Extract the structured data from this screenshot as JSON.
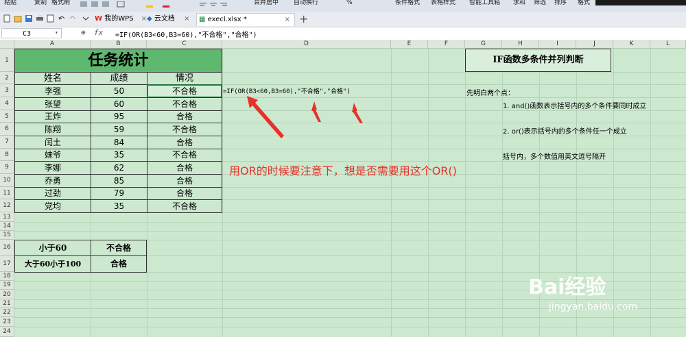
{
  "ribbon": {
    "labels": [
      "粘贴",
      "复制",
      "格式刷",
      "合并居中",
      "自动换行",
      "条件格式",
      "表格样式",
      "智能工具箱",
      "求和",
      "筛选",
      "排序",
      "格式"
    ],
    "percent": "%"
  },
  "tabs": [
    {
      "label": "我的WPS"
    },
    {
      "label": "云文档"
    },
    {
      "label": "execl.xlsx *"
    }
  ],
  "formula_bar": {
    "cell_ref": "C3",
    "fx": "fx",
    "formula": "=IF(OR(B3<60,B3=60),\"不合格\",\"合格\")"
  },
  "columns": [
    "A",
    "B",
    "C",
    "D",
    "E",
    "F",
    "G",
    "H",
    "I",
    "J",
    "K",
    "L"
  ],
  "rows": [
    "1",
    "2",
    "3",
    "4",
    "5",
    "6",
    "7",
    "8",
    "9",
    "10",
    "11",
    "12",
    "13",
    "14",
    "15",
    "16",
    "17",
    "18",
    "19",
    "20",
    "21",
    "22",
    "23",
    "24"
  ],
  "table": {
    "title": "任务统计",
    "headers": [
      "姓名",
      "成绩",
      "情况"
    ],
    "records": [
      {
        "name": "李强",
        "score": "50",
        "status": "不合格"
      },
      {
        "name": "张望",
        "score": "60",
        "status": "不合格"
      },
      {
        "name": "王炸",
        "score": "95",
        "status": "合格"
      },
      {
        "name": "陈翔",
        "score": "59",
        "status": "不合格"
      },
      {
        "name": "闰土",
        "score": "84",
        "status": "合格"
      },
      {
        "name": "妹爷",
        "score": "35",
        "status": "不合格"
      },
      {
        "name": "李娜",
        "score": "62",
        "status": "合格"
      },
      {
        "name": "乔勇",
        "score": "85",
        "status": "合格"
      },
      {
        "name": "过劲",
        "score": "79",
        "status": "合格"
      },
      {
        "name": "党均",
        "score": "35",
        "status": "不合格"
      }
    ]
  },
  "legend": [
    {
      "condition": "小于60",
      "result": "不合格"
    },
    {
      "condition": "大于60小于100",
      "result": "合格"
    }
  ],
  "annotation": {
    "d3_formula": "=IF(OR(B3<60,B3=60),\"不合格\",\"合格\")",
    "note": "用OR的时候要注意下，想是否需要用这个OR()"
  },
  "side": {
    "title": "IF函数多条件并列判断",
    "intro": "先明白两个点：",
    "point1": "1. and()函数表示括号内的多个条件要同时成立",
    "point2": "2. or()表示括号内的多个条件任一个成立",
    "point3": "括号内，多个数值用英文逗号隔开"
  },
  "watermark": {
    "brand": "Bai经验",
    "url": "jingyan.baidu.com"
  },
  "colors": {
    "accent_red": "#e8302a",
    "header_green": "#5fb870",
    "sheet_bg": "#cce8cf"
  }
}
